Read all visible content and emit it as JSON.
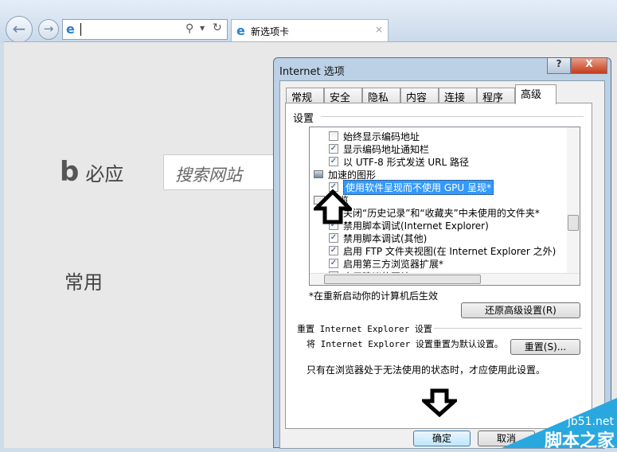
{
  "browser": {
    "tab_title": "新选项卡",
    "address_value": ""
  },
  "newtab": {
    "brand": "必应",
    "search_placeholder": "搜索网站",
    "frequent": "常用"
  },
  "dialog": {
    "title": "Internet 选项",
    "help": "?",
    "close": "X",
    "tabs": [
      {
        "label": "常规"
      },
      {
        "label": "安全"
      },
      {
        "label": "隐私"
      },
      {
        "label": "内容"
      },
      {
        "label": "连接"
      },
      {
        "label": "程序"
      },
      {
        "label": "高级",
        "active": true
      }
    ],
    "settings_label": "设置",
    "items": [
      {
        "label": "始终显示编码地址",
        "checked": false
      },
      {
        "label": "显示编码地址通知栏",
        "checked": true
      },
      {
        "label": "以 UTF-8 形式发送 URL 路径",
        "checked": true
      },
      {
        "label": "加速的图形",
        "group": true
      },
      {
        "label": "使用软件呈现而不使用 GPU 呈现*",
        "checked": true,
        "selected": true
      },
      {
        "label": "浏览",
        "group": true
      },
      {
        "label": "关闭“历史记录”和“收藏夹”中未使用的文件夹*",
        "checked": true
      },
      {
        "label": "禁用脚本调试(Internet Explorer)",
        "checked": true
      },
      {
        "label": "禁用脚本调试(其他)",
        "checked": true
      },
      {
        "label": "启用 FTP 文件夹视图(在 Internet Explorer 之外)",
        "checked": true
      },
      {
        "label": "启用第三方浏览器扩展*",
        "checked": true
      },
      {
        "label": "启用建议的网站",
        "checked": false
      }
    ],
    "restart_note": "*在重新启动你的计算机后生效",
    "restore_button": "还原高级设置(R)",
    "reset_header": "重置 Internet Explorer 设置",
    "reset_desc": "将 Internet Explorer 设置重置为默认设置。",
    "reset_button": "重置(S)...",
    "reset_note": "只有在浏览器处于无法使用的状态时，才应使用此设置。",
    "ok_button": "确定",
    "cancel_button": "取消"
  },
  "watermark": {
    "site": "jb51.net",
    "name": "脚本之家"
  }
}
